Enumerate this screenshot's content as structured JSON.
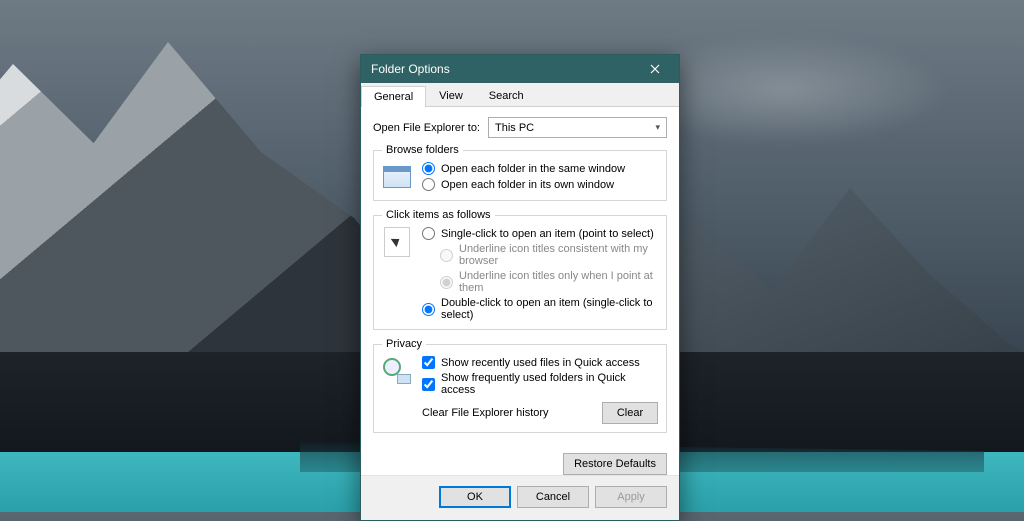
{
  "window": {
    "title": "Folder Options"
  },
  "tabs": {
    "general": "General",
    "view": "View",
    "search": "Search"
  },
  "open_to": {
    "label": "Open File Explorer to:",
    "value": "This PC"
  },
  "browse": {
    "legend": "Browse folders",
    "same": "Open each folder in the same window",
    "own": "Open each folder in its own window"
  },
  "click": {
    "legend": "Click items as follows",
    "single": "Single-click to open an item (point to select)",
    "u_browser": "Underline icon titles consistent with my browser",
    "u_point": "Underline icon titles only when I point at them",
    "double": "Double-click to open an item (single-click to select)"
  },
  "privacy": {
    "legend": "Privacy",
    "recent": "Show recently used files in Quick access",
    "frequent": "Show frequently used folders in Quick access",
    "clear_label": "Clear File Explorer history",
    "clear_btn": "Clear"
  },
  "buttons": {
    "restore": "Restore Defaults",
    "ok": "OK",
    "cancel": "Cancel",
    "apply": "Apply"
  }
}
